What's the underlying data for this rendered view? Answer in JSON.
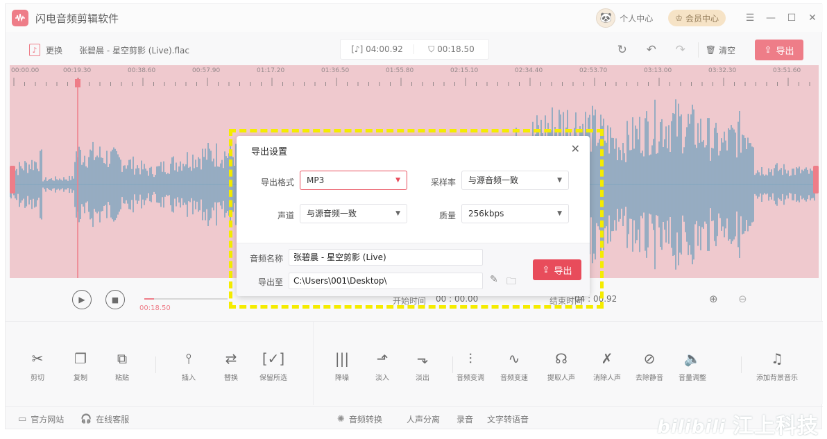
{
  "app": {
    "title": "闪电音频剪辑软件",
    "personal": "个人中心",
    "vip": "会员中心"
  },
  "toolbar": {
    "replace_label": "更换",
    "filename": "张碧晨 - 星空剪影 (Live).flac",
    "total_time": "04:00.92",
    "selected_time": "00:18.50",
    "clear_label": "清空",
    "export_label": "导出"
  },
  "ruler": {
    "ticks": [
      "00:00.00",
      "00:19.30",
      "00:38.60",
      "00:57.90",
      "01:17.20",
      "01:36.50",
      "01:55.80",
      "02:15.10",
      "02:34.40",
      "02:53.70",
      "03:13.00",
      "03:32.30",
      "03:51.60"
    ]
  },
  "player": {
    "current_time": "00:18.50",
    "progress": 0.12,
    "start_label": "开始时间",
    "start_value": "00 : 00.00",
    "end_label": "结束时间",
    "end_value": "04 : 00.92"
  },
  "functions": [
    {
      "label": "剪切",
      "icon": "scissors-icon"
    },
    {
      "label": "复制",
      "icon": "copy-icon"
    },
    {
      "label": "粘贴",
      "icon": "paste-icon"
    },
    {
      "label": "插入",
      "icon": "insert-icon"
    },
    {
      "label": "替换",
      "icon": "replace-icon"
    },
    {
      "label": "保留所选",
      "icon": "keep-selection-icon"
    },
    {
      "label": "降噪",
      "icon": "denoise-icon"
    },
    {
      "label": "淡入",
      "icon": "fade-in-icon"
    },
    {
      "label": "淡出",
      "icon": "fade-out-icon"
    },
    {
      "label": "音频变调",
      "icon": "pitch-icon"
    },
    {
      "label": "音频变速",
      "icon": "speed-icon"
    },
    {
      "label": "提取人声",
      "icon": "extract-voice-icon"
    },
    {
      "label": "消除人声",
      "icon": "remove-voice-icon"
    },
    {
      "label": "去除静音",
      "icon": "remove-silence-icon"
    },
    {
      "label": "音量调整",
      "icon": "volume-icon"
    },
    {
      "label": "添加背景音乐",
      "icon": "bgm-icon"
    }
  ],
  "footer": {
    "website": "官方网站",
    "support": "在线客服",
    "convert": "音频转换",
    "separate": "人声分离",
    "record": "录音",
    "tts": "文字转语音",
    "watermark": "江上科技"
  },
  "dialog": {
    "title": "导出设置",
    "format_label": "导出格式",
    "format_value": "MP3",
    "samplerate_label": "采样率",
    "samplerate_value": "与源音频一致",
    "channel_label": "声道",
    "channel_value": "与源音频一致",
    "quality_label": "质量",
    "quality_value": "256kbps",
    "name_label": "音频名称",
    "name_value": "张碧晨 - 星空剪影 (Live)",
    "path_label": "导出至",
    "path_value": "C:\\Users\\001\\Desktop\\",
    "export_label": "导出"
  },
  "colors": {
    "accent": "#e84c5b",
    "wave": "#4f83a6",
    "highlight": "#f5ec00"
  }
}
